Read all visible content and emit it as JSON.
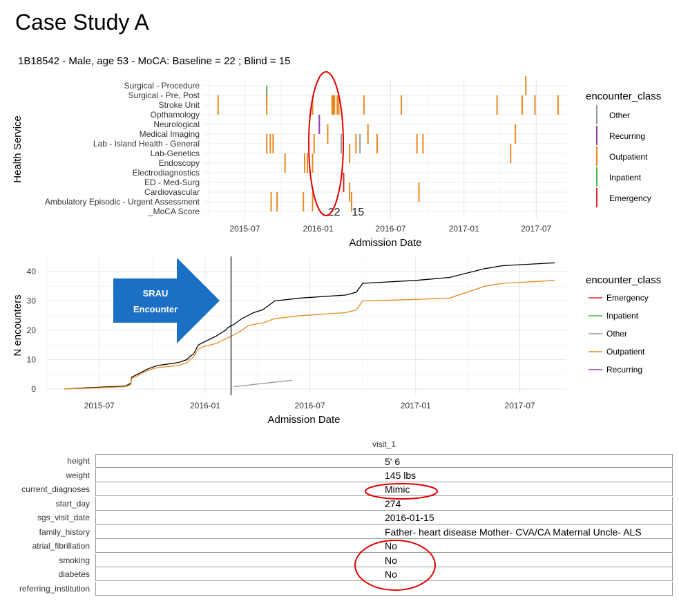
{
  "page": {
    "title": "Case Study A",
    "subtitle": "1B18542 - Male, age 53 - MoCA: Baseline = 22 ; Blind = 15"
  },
  "colors": {
    "Other": "#999999",
    "Recurring": "#8e44ad",
    "Outpatient": "#e8891e",
    "Inpatient": "#4caf50",
    "Emergency": "#d62728",
    "Total": "#000000",
    "annotation": "#e00000",
    "arrow": "#1b6fc4"
  },
  "arrow": {
    "line1": "SRAU",
    "line2": "Encounter"
  },
  "chart_data": [
    {
      "type": "scatter",
      "title": "",
      "xlabel": "Admission Date",
      "ylabel": "Health Service",
      "x_ticks": [
        "2015-07",
        "2016-01",
        "2016-07",
        "2017-01",
        "2017-07"
      ],
      "categories": [
        "Surgical - Procedure",
        "Surgical - Pre, Post",
        "Stroke Unit",
        "Opthamology",
        "Neurological",
        "Medical Imaging",
        "Lab - Island Health - General",
        "Lab-Genetics",
        "Endoscopy",
        "Electrodiagnostics",
        "ED - Med-Surg",
        "Cardiovascular",
        "Ambulatory Episodic - Urgent Assessment",
        "_MoCA Score"
      ],
      "legend_title": "encounter_class",
      "legend": [
        "Other",
        "Recurring",
        "Outpatient",
        "Inpatient",
        "Emergency"
      ],
      "legend_position": "right",
      "grid": true,
      "moca_labels": [
        {
          "x": "2016-02-10",
          "text": "22"
        },
        {
          "x": "2016-04-10",
          "text": "15"
        }
      ],
      "events": [
        {
          "cat": "Surgical - Procedure",
          "x": "2017-06-05",
          "class": "Outpatient"
        },
        {
          "cat": "Surgical - Pre, Post",
          "x": "2015-08-25",
          "class": "Inpatient"
        },
        {
          "cat": "Stroke Unit",
          "x": "2015-04-25",
          "class": "Outpatient"
        },
        {
          "cat": "Stroke Unit",
          "x": "2015-08-25",
          "class": "Outpatient"
        },
        {
          "cat": "Stroke Unit",
          "x": "2015-12-18",
          "class": "Outpatient"
        },
        {
          "cat": "Stroke Unit",
          "x": "2016-02-05",
          "class": "Outpatient"
        },
        {
          "cat": "Stroke Unit",
          "x": "2016-02-08",
          "class": "Outpatient"
        },
        {
          "cat": "Stroke Unit",
          "x": "2016-02-11",
          "class": "Outpatient"
        },
        {
          "cat": "Stroke Unit",
          "x": "2016-02-18",
          "class": "Outpatient"
        },
        {
          "cat": "Stroke Unit",
          "x": "2016-02-22",
          "class": "Outpatient"
        },
        {
          "cat": "Stroke Unit",
          "x": "2016-04-25",
          "class": "Outpatient"
        },
        {
          "cat": "Stroke Unit",
          "x": "2016-07-28",
          "class": "Outpatient"
        },
        {
          "cat": "Stroke Unit",
          "x": "2017-03-25",
          "class": "Outpatient"
        },
        {
          "cat": "Stroke Unit",
          "x": "2017-05-27",
          "class": "Outpatient"
        },
        {
          "cat": "Stroke Unit",
          "x": "2017-06-28",
          "class": "Outpatient"
        },
        {
          "cat": "Stroke Unit",
          "x": "2017-08-25",
          "class": "Outpatient"
        },
        {
          "cat": "Neurological",
          "x": "2016-01-04",
          "class": "Recurring"
        },
        {
          "cat": "Medical Imaging",
          "x": "2016-01-25",
          "class": "Outpatient"
        },
        {
          "cat": "Medical Imaging",
          "x": "2016-05-05",
          "class": "Outpatient"
        },
        {
          "cat": "Medical Imaging",
          "x": "2017-05-10",
          "class": "Outpatient"
        },
        {
          "cat": "Lab - Island Health - General",
          "x": "2015-08-25",
          "class": "Outpatient"
        },
        {
          "cat": "Lab - Island Health - General",
          "x": "2015-09-03",
          "class": "Outpatient"
        },
        {
          "cat": "Lab - Island Health - General",
          "x": "2015-09-10",
          "class": "Outpatient"
        },
        {
          "cat": "Lab - Island Health - General",
          "x": "2015-12-22",
          "class": "Outpatient"
        },
        {
          "cat": "Lab - Island Health - General",
          "x": "2016-02-28",
          "class": "Other"
        },
        {
          "cat": "Lab - Island Health - General",
          "x": "2016-04-05",
          "class": "Outpatient"
        },
        {
          "cat": "Lab - Island Health - General",
          "x": "2016-04-15",
          "class": "Other"
        },
        {
          "cat": "Lab - Island Health - General",
          "x": "2016-05-28",
          "class": "Outpatient"
        },
        {
          "cat": "Lab - Island Health - General",
          "x": "2016-09-05",
          "class": "Outpatient"
        },
        {
          "cat": "Lab - Island Health - General",
          "x": "2016-09-20",
          "class": "Outpatient"
        },
        {
          "cat": "Lab-Genetics",
          "x": "2016-03-20",
          "class": "Outpatient"
        },
        {
          "cat": "Lab-Genetics",
          "x": "2017-04-28",
          "class": "Outpatient"
        },
        {
          "cat": "Endoscopy",
          "x": "2015-10-10",
          "class": "Outpatient"
        },
        {
          "cat": "Endoscopy",
          "x": "2015-11-28",
          "class": "Outpatient"
        },
        {
          "cat": "Endoscopy",
          "x": "2015-12-05",
          "class": "Outpatient"
        },
        {
          "cat": "Endoscopy",
          "x": "2015-12-18",
          "class": "Outpatient"
        },
        {
          "cat": "ED - Med-Surg",
          "x": "2016-03-05",
          "class": "Emergency"
        },
        {
          "cat": "Cardiovascular",
          "x": "2016-03-20",
          "class": "Outpatient"
        },
        {
          "cat": "Cardiovascular",
          "x": "2016-09-10",
          "class": "Outpatient"
        },
        {
          "cat": "Ambulatory Episodic - Urgent Assessment",
          "x": "2015-09-05",
          "class": "Outpatient"
        },
        {
          "cat": "Ambulatory Episodic - Urgent Assessment",
          "x": "2015-09-20",
          "class": "Outpatient"
        },
        {
          "cat": "Ambulatory Episodic - Urgent Assessment",
          "x": "2015-11-25",
          "class": "Outpatient"
        },
        {
          "cat": "Ambulatory Episodic - Urgent Assessment",
          "x": "2015-12-18",
          "class": "Outpatient"
        },
        {
          "cat": "Ambulatory Episodic - Urgent Assessment",
          "x": "2016-03-25",
          "class": "Outpatient"
        }
      ]
    },
    {
      "type": "line",
      "title": "",
      "xlabel": "Admission Date",
      "ylabel": "N encounters",
      "x_ticks": [
        "2015-07",
        "2016-01",
        "2016-07",
        "2017-01",
        "2017-07"
      ],
      "ylim": [
        0,
        44
      ],
      "y_ticks": [
        0,
        10,
        20,
        30,
        40
      ],
      "legend_title": "encounter_class",
      "legend": [
        "Emergency",
        "Inpatient",
        "Other",
        "Outpatient",
        "Recurring"
      ],
      "legend_position": "right",
      "grid": true,
      "vline_x": "2016-02-15",
      "series": [
        {
          "class": "Total",
          "points": [
            [
              "2015-05-01",
              0
            ],
            [
              "2015-06-15",
              0.5
            ],
            [
              "2015-08-15",
              1
            ],
            [
              "2015-08-25",
              2
            ],
            [
              "2015-08-26",
              4
            ],
            [
              "2015-09-05",
              5
            ],
            [
              "2015-09-15",
              6
            ],
            [
              "2015-09-25",
              7
            ],
            [
              "2015-10-10",
              8
            ],
            [
              "2015-11-15",
              9
            ],
            [
              "2015-11-30",
              10
            ],
            [
              "2015-12-05",
              11
            ],
            [
              "2015-12-12",
              12
            ],
            [
              "2015-12-20",
              15
            ],
            [
              "2015-12-30",
              16
            ],
            [
              "2016-01-20",
              18
            ],
            [
              "2016-02-05",
              20
            ],
            [
              "2016-02-10",
              21
            ],
            [
              "2016-02-20",
              22
            ],
            [
              "2016-03-05",
              24
            ],
            [
              "2016-03-15",
              25
            ],
            [
              "2016-03-25",
              26
            ],
            [
              "2016-04-10",
              27
            ],
            [
              "2016-05-01",
              30
            ],
            [
              "2016-06-15",
              31
            ],
            [
              "2016-09-01",
              32
            ],
            [
              "2016-09-20",
              33
            ],
            [
              "2016-10-01",
              36
            ],
            [
              "2017-01-01",
              37
            ],
            [
              "2017-03-01",
              38
            ],
            [
              "2017-05-01",
              41
            ],
            [
              "2017-06-01",
              42
            ],
            [
              "2017-08-31",
              43
            ]
          ]
        },
        {
          "class": "Outpatient",
          "points": [
            [
              "2015-05-01",
              0
            ],
            [
              "2015-06-15",
              0.3
            ],
            [
              "2015-08-15",
              0.8
            ],
            [
              "2015-08-25",
              1.5
            ],
            [
              "2015-08-26",
              3.5
            ],
            [
              "2015-09-05",
              4.5
            ],
            [
              "2015-09-15",
              5.5
            ],
            [
              "2015-09-25",
              6.5
            ],
            [
              "2015-10-10",
              7.3
            ],
            [
              "2015-11-15",
              8
            ],
            [
              "2015-11-30",
              9
            ],
            [
              "2015-12-05",
              10
            ],
            [
              "2015-12-12",
              11
            ],
            [
              "2015-12-20",
              13.5
            ],
            [
              "2015-12-30",
              14.5
            ],
            [
              "2016-01-20",
              15.5
            ],
            [
              "2016-02-05",
              17
            ],
            [
              "2016-02-10",
              17.5
            ],
            [
              "2016-02-20",
              18.5
            ],
            [
              "2016-03-05",
              20
            ],
            [
              "2016-03-15",
              21.5
            ],
            [
              "2016-03-25",
              22
            ],
            [
              "2016-04-10",
              22.5
            ],
            [
              "2016-05-01",
              24
            ],
            [
              "2016-06-15",
              25
            ],
            [
              "2016-09-01",
              26
            ],
            [
              "2016-09-20",
              27
            ],
            [
              "2016-10-01",
              30
            ],
            [
              "2017-01-01",
              30.5
            ],
            [
              "2017-03-01",
              31
            ],
            [
              "2017-05-01",
              35
            ],
            [
              "2017-06-01",
              36
            ],
            [
              "2017-08-31",
              37
            ]
          ]
        },
        {
          "class": "Other",
          "points": [
            [
              "2016-02-20",
              0.8
            ],
            [
              "2016-05-31",
              3
            ]
          ]
        }
      ]
    }
  ],
  "table": {
    "column": "visit_1",
    "rows": [
      {
        "label": "height",
        "value": "5' 6"
      },
      {
        "label": "weight",
        "value": "145 lbs"
      },
      {
        "label": "current_diagnoses",
        "value": "Mimic"
      },
      {
        "label": "start_day",
        "value": "274"
      },
      {
        "label": "sgs_visit_date",
        "value": "2016-01-15"
      },
      {
        "label": "family_history",
        "value": "Father- heart disease  Mother- CVA/CA  Maternal Uncle- ALS"
      },
      {
        "label": "atrial_fibrillation",
        "value": "No"
      },
      {
        "label": "smoking",
        "value": "No"
      },
      {
        "label": "diabetes",
        "value": "No"
      },
      {
        "label": "referring_institution",
        "value": ""
      }
    ]
  }
}
